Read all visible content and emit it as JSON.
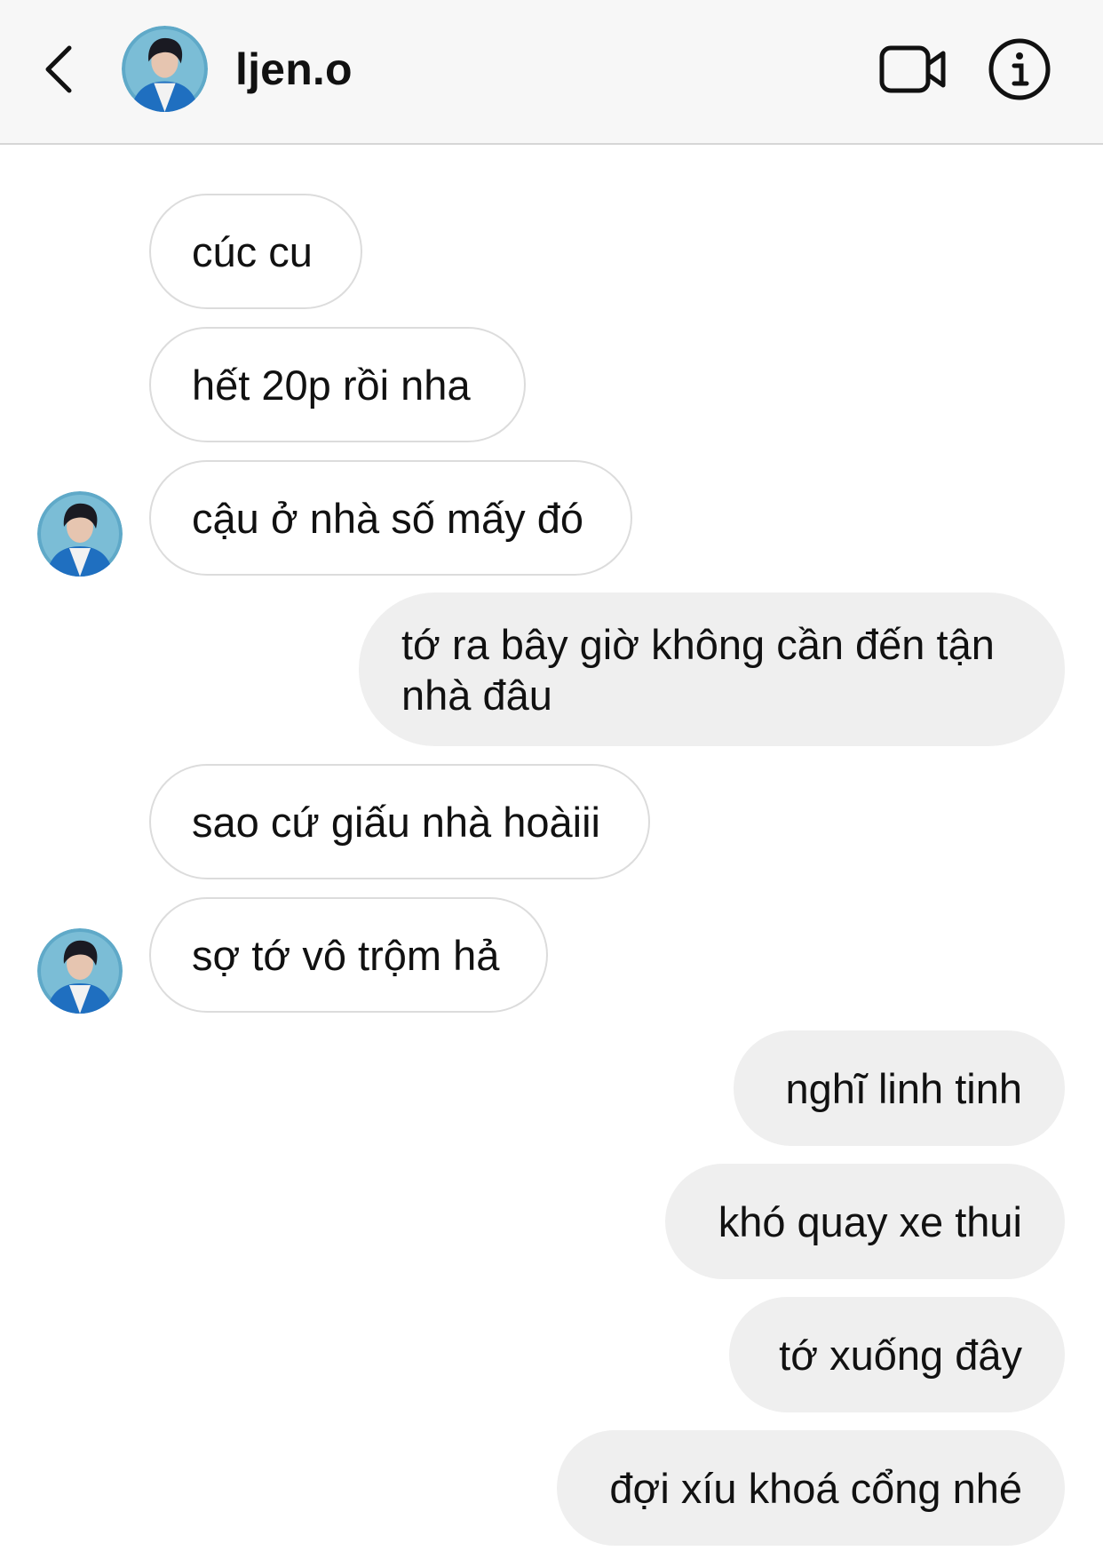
{
  "header": {
    "username": "ljen.o",
    "icons": {
      "back": "chevron-left-icon",
      "video": "video-camera-icon",
      "info": "info-icon"
    }
  },
  "messages": [
    {
      "side": "received",
      "text": "cúc cu"
    },
    {
      "side": "received",
      "text": "hết 20p rồi nha"
    },
    {
      "side": "received",
      "text": "cậu ở nhà số mấy đó"
    },
    {
      "side": "sent",
      "text": "tớ ra bây giờ không cần đến tận nhà đâu"
    },
    {
      "side": "received",
      "text": "sao cứ giấu nhà hoàiii"
    },
    {
      "side": "received",
      "text": "sợ tớ vô trộm hả"
    },
    {
      "side": "sent",
      "text": "nghĩ linh tinh"
    },
    {
      "side": "sent",
      "text": "khó quay xe thui"
    },
    {
      "side": "sent",
      "text": "tớ xuống đây"
    },
    {
      "side": "sent",
      "text": "đợi xíu khoá cổng nhé"
    }
  ],
  "colors": {
    "header_bg": "#f7f7f7",
    "received_bubble_bg": "#ffffff",
    "received_bubble_border": "#dcdcdc",
    "sent_bubble_bg": "#efefef",
    "text": "#111111"
  }
}
